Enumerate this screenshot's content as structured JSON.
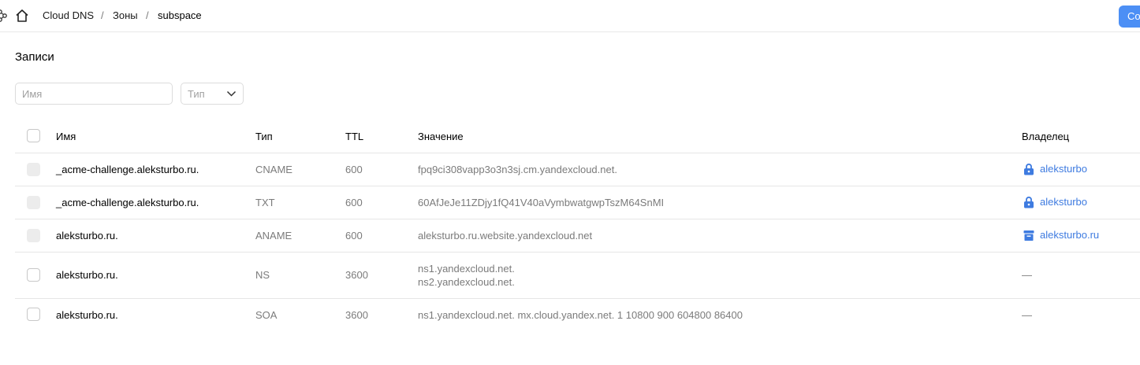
{
  "header": {
    "breadcrumbs": [
      "Cloud DNS",
      "Зоны",
      "subspace"
    ],
    "separator": "/",
    "create_button": "Со"
  },
  "section": {
    "title": "Записи"
  },
  "filters": {
    "name_placeholder": "Имя",
    "type_placeholder": "Тип"
  },
  "table": {
    "columns": {
      "name": "Имя",
      "type": "Тип",
      "ttl": "TTL",
      "value": "Значение",
      "owner": "Владелец"
    },
    "rows": [
      {
        "name": "_acme-challenge.aleksturbo.ru.",
        "type": "CNAME",
        "ttl": "600",
        "value": "fpq9ci308vapp3o3n3sj.cm.yandexcloud.net.",
        "owner": "aleksturbo",
        "owner_icon": "lock-icon"
      },
      {
        "name": "_acme-challenge.aleksturbo.ru.",
        "type": "TXT",
        "ttl": "600",
        "value": "60AfJeJe11ZDjy1fQ41V40aVymbwatgwpTszM64SnMI",
        "owner": "aleksturbo",
        "owner_icon": "lock-icon"
      },
      {
        "name": "aleksturbo.ru.",
        "type": "ANAME",
        "ttl": "600",
        "value": "aleksturbo.ru.website.yandexcloud.net",
        "owner": "aleksturbo.ru",
        "owner_icon": "bucket-icon"
      },
      {
        "name": "aleksturbo.ru.",
        "type": "NS",
        "ttl": "3600",
        "value_lines": [
          "ns1.yandexcloud.net.",
          "ns2.yandexcloud.net."
        ],
        "owner": "—"
      },
      {
        "name": "aleksturbo.ru.",
        "type": "SOA",
        "ttl": "3600",
        "value": "ns1.yandexcloud.net. mx.cloud.yandex.net. 1 10800 900 604800 86400",
        "owner": "—"
      }
    ]
  },
  "colors": {
    "accent": "#4c8ff5",
    "link": "#3e7be0",
    "muted_text": "#7b7b7b",
    "border": "#e6e6e6"
  }
}
